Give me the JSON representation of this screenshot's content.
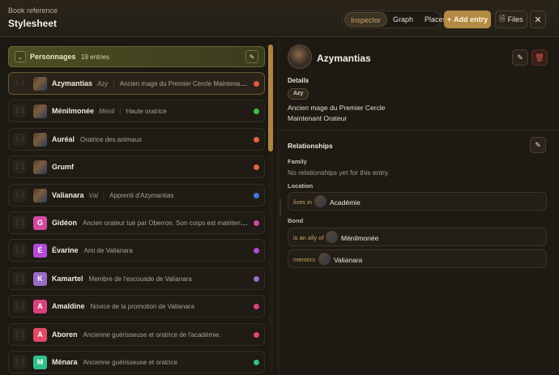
{
  "header": {
    "subtitle": "Book reference",
    "title": "Stylesheet",
    "tabs": [
      {
        "label": "Inspector",
        "active": true
      },
      {
        "label": "Graph",
        "active": false
      },
      {
        "label": "Places",
        "active": false
      }
    ],
    "add_entry": "Add entry",
    "add_icon": "+",
    "files": "Files",
    "files_icon": "🗎",
    "close_icon": "✕"
  },
  "colors": {
    "accent": "#b38a44",
    "group_bg": "#4b4d22",
    "danger": "#e0574a"
  },
  "group": {
    "name": "Personnages",
    "count": "19 entries",
    "chevron": "⌄",
    "edit_icon": "✎"
  },
  "rows": [
    {
      "name": "Azymantias",
      "alias": "Azy",
      "desc": "Ancien mage du Premier Cercle Maintenant Orateur",
      "dot": "#e05a4a",
      "avatar_type": "image",
      "selected": true
    },
    {
      "name": "Ménilmonée",
      "alias": "Ménil",
      "desc": "Haute oratrice",
      "dot": "#3cc44a",
      "avatar_type": "image"
    },
    {
      "name": "Auréal",
      "alias": "",
      "desc": "Oratrice des animaux",
      "dot": "#e0623e",
      "avatar_type": "image"
    },
    {
      "name": "Grumf",
      "alias": "",
      "desc": "",
      "dot": "#e0623e",
      "avatar_type": "image"
    },
    {
      "name": "Valianara",
      "alias": "Val",
      "desc": "Apprenti d'Azymantias",
      "dot": "#3f78e0",
      "avatar_type": "image"
    },
    {
      "name": "Gidéon",
      "alias": "",
      "desc": "Ancien orateur tué par Oberron. Son corps est maintenant occ...",
      "dot": "#d04aa0",
      "avatar_type": "letter",
      "letter": "G",
      "avatar_color": "#d04aa0"
    },
    {
      "name": "Évarine",
      "alias": "",
      "desc": "Ami de Valianara",
      "dot": "#b24ad8",
      "avatar_type": "letter",
      "letter": "É",
      "avatar_color": "#b24ad8"
    },
    {
      "name": "Kamartel",
      "alias": "",
      "desc": "Membre de l'escouade de Valianara",
      "dot": "#9a6cc8",
      "avatar_type": "letter",
      "letter": "K",
      "avatar_color": "#9a6cc8"
    },
    {
      "name": "Amaldine",
      "alias": "",
      "desc": "Novice de la promotion de Valianara",
      "dot": "#d8427e",
      "avatar_type": "letter",
      "letter": "A",
      "avatar_color": "#d8427e"
    },
    {
      "name": "Aboren",
      "alias": "",
      "desc": "Ancienne guérisseuse et oratrice de l'académie.",
      "dot": "#e04a66",
      "avatar_type": "letter",
      "letter": "A",
      "avatar_color": "#e04a66"
    },
    {
      "name": "Ménara",
      "alias": "",
      "desc": "Ancienne guérisseuse et oratrice",
      "dot": "#2fc08a",
      "avatar_type": "letter",
      "letter": "M",
      "avatar_color": "#2fc08a"
    }
  ],
  "entry": {
    "title": "Azymantias",
    "edit_icon": "✎",
    "delete_icon": "🗑",
    "details_label": "Details",
    "alias_pill": "Azy",
    "description_line1": "Ancien mage du Premier Cercle",
    "description_line2": "Maintenant Orateur",
    "relationships_label": "Relationships",
    "rel_edit_icon": "✎",
    "family_label": "Family",
    "family_empty": "No relationships yet for this entry.",
    "location_label": "Location",
    "location": {
      "verb": "lives in",
      "name": "Académie"
    },
    "bond_label": "Bond",
    "bonds": [
      {
        "verb": "is an ally of",
        "name": "Ménilmonée"
      },
      {
        "verb": "mentors",
        "name": "Valianara"
      }
    ]
  }
}
